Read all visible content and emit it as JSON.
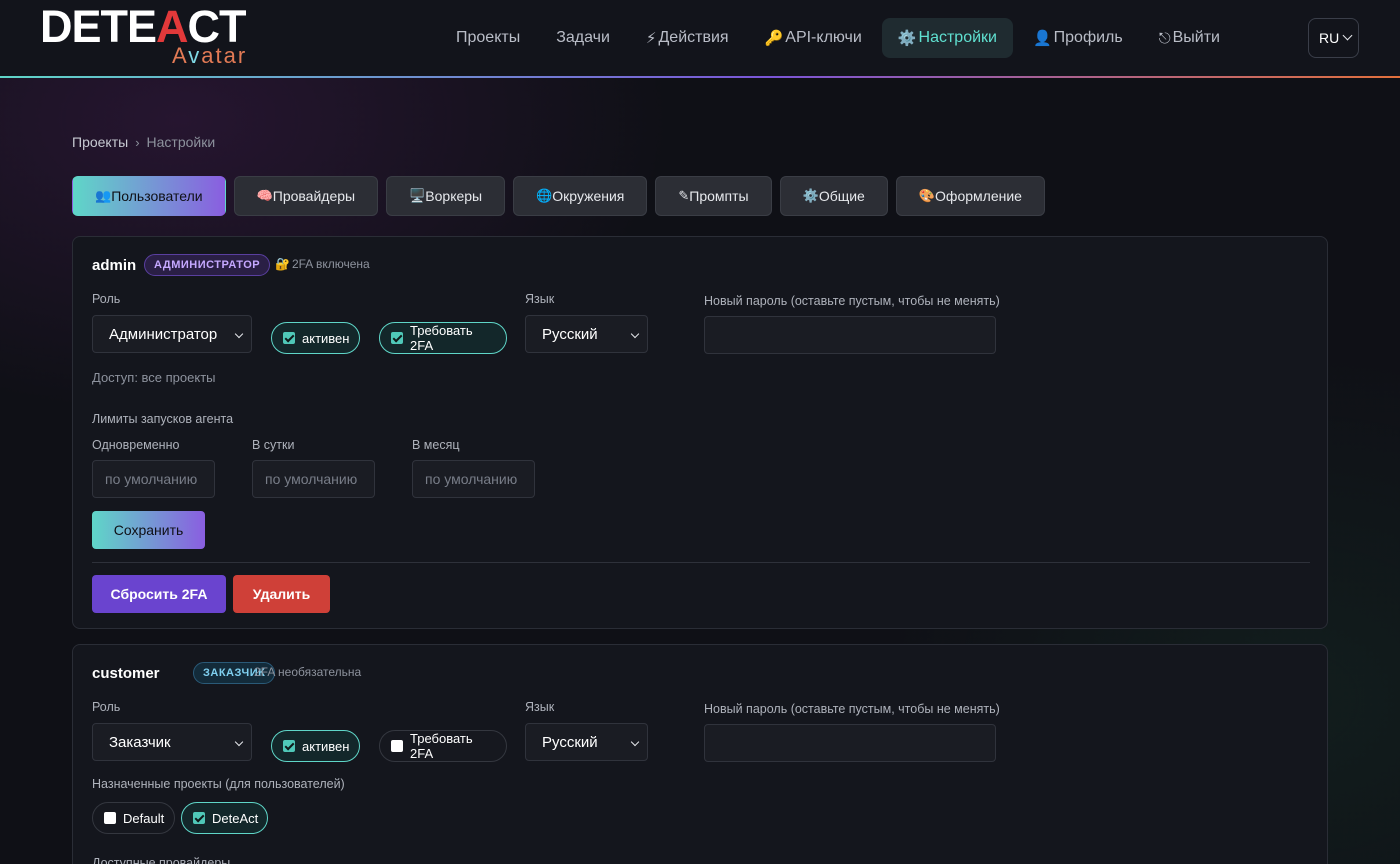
{
  "logo": {
    "main_left": "DETE",
    "main_accent": "A",
    "main_right": "CT",
    "sub_left": "A",
    "sub_accent": "v",
    "sub_right": "atar"
  },
  "nav": {
    "items": [
      {
        "icon": "",
        "label": "Проекты"
      },
      {
        "icon": "⚡",
        "label": "Действия",
        "before": "Задачи"
      },
      {
        "icon": "🔑",
        "label": "API-ключи"
      },
      {
        "icon": "⚙️",
        "label": "Настройки",
        "active": true
      },
      {
        "icon": "👤",
        "label": "Профиль"
      },
      {
        "icon": "⎋",
        "label": "Выйти"
      }
    ],
    "tasks_label": "Задачи",
    "lang": "RU"
  },
  "breadcrumb": {
    "root": "Проекты",
    "sep": "›",
    "current": "Настройки"
  },
  "tabs": [
    {
      "icon": "👥",
      "label": "Пользователи"
    },
    {
      "icon": "🧠",
      "label": "Провайдеры"
    },
    {
      "icon": "🖥️",
      "label": "Воркеры"
    },
    {
      "icon": "🌐",
      "label": "Окружения"
    },
    {
      "icon": "✎",
      "label": "Промпты"
    },
    {
      "icon": "⚙️",
      "label": "Общие"
    },
    {
      "icon": "🎨",
      "label": "Оформление"
    }
  ],
  "users": [
    {
      "name": "admin",
      "badge": "АДМИНИСТРАТОР",
      "twofa_icon": "🔐",
      "twofa_status": "2FA включена",
      "role_label": "Роль",
      "role_value": "Администратор",
      "active_label": "активен",
      "require2fa_label": "Требовать 2FA",
      "lang_label": "Язык",
      "lang_value": "Русский",
      "password_label": "Новый пароль (оставьте пустым, чтобы не менять)",
      "access_text": "Доступ: все проекты",
      "limits_title": "Лимиты запусков агента",
      "limit_concurrent_label": "Одновременно",
      "limit_daily_label": "В сутки",
      "limit_monthly_label": "В месяц",
      "limit_placeholder": "по умолчанию",
      "save_label": "Сохранить",
      "reset2fa_label": "Сбросить 2FA",
      "delete_label": "Удалить"
    },
    {
      "name": "customer",
      "badge": "ЗАКАЗЧИК",
      "twofa_status": "2FA необязательна",
      "role_label": "Роль",
      "role_value": "Заказчик",
      "active_label": "активен",
      "require2fa_label": "Требовать 2FA",
      "lang_label": "Язык",
      "lang_value": "Русский",
      "password_label": "Новый пароль (оставьте пустым, чтобы не менять)",
      "projects_label": "Назначенные проекты (для пользователей)",
      "projects": [
        {
          "label": "Default",
          "checked": false
        },
        {
          "label": "DeteAct",
          "checked": true
        }
      ],
      "providers_label": "Доступные провайдеры"
    }
  ],
  "colors": {
    "accent_teal": "#5fd6c8",
    "accent_purple": "#8a5ee0",
    "danger": "#cf4038",
    "reset": "#6a44cf"
  }
}
